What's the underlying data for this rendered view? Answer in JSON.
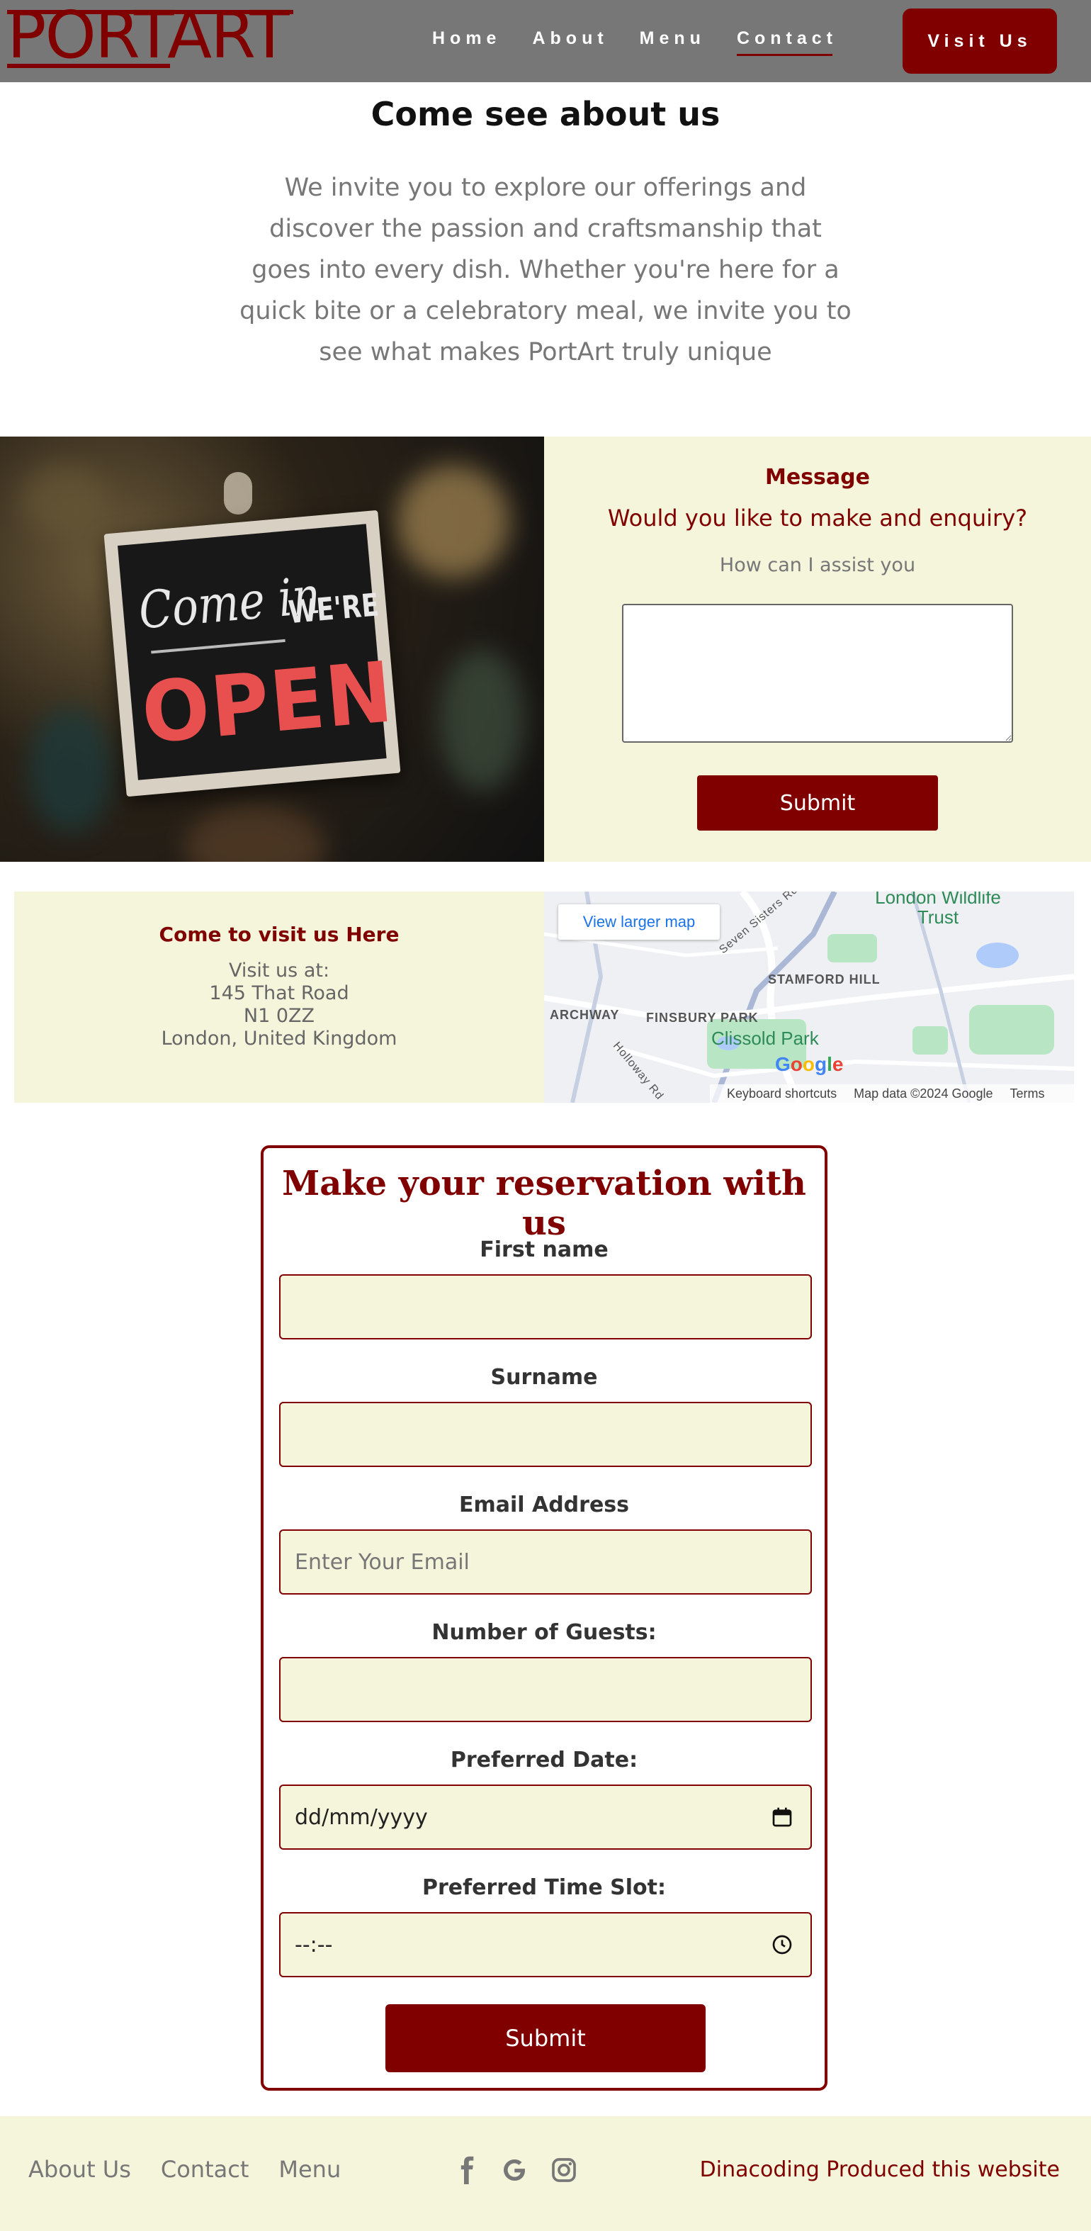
{
  "brand": {
    "logo_text": "PORTART"
  },
  "nav": {
    "links": [
      "Home",
      "About",
      "Menu",
      "Contact"
    ],
    "active": "Contact",
    "visit_button": "Visit Us"
  },
  "intro": {
    "title": "Come see about us",
    "text": "We invite you to explore our offerings and discover the passion and craftsmanship that goes into every dish. Whether you're here for a quick bite or a celebratory meal, we invite you to see what makes PortArt truly unique"
  },
  "photo": {
    "sign_line1": "Come in",
    "sign_line2": "WE'RE",
    "sign_line3": "OPEN"
  },
  "message": {
    "label": "Message",
    "title": "Would you like to make and enquiry?",
    "subtitle": "How can I assist you",
    "textarea_value": "",
    "submit": "Submit"
  },
  "visit": {
    "title": "Come to visit us Here",
    "lines": [
      "Visit us at:",
      "145 That Road",
      "N1 0ZZ",
      "London, United Kingdom"
    ]
  },
  "map": {
    "larger_link": "View larger map",
    "labels": [
      "London Wildlife Trust",
      "STAMFORD HILL",
      "ARCHWAY",
      "FINSBURY PARK",
      "Clissold Park",
      "Seven Sisters Rd",
      "Holloway Rd"
    ],
    "logo": "Google",
    "footer": [
      "Keyboard shortcuts",
      "Map data ©2024 Google",
      "Terms"
    ]
  },
  "reservation": {
    "title": "Make your reservation with us",
    "fields": [
      {
        "label": "First name",
        "value": "",
        "placeholder": ""
      },
      {
        "label": "Surname",
        "value": "",
        "placeholder": ""
      },
      {
        "label": "Email Address",
        "value": "",
        "placeholder": "Enter Your Email"
      },
      {
        "label": "Number of Guests:",
        "value": "",
        "placeholder": ""
      },
      {
        "label": "Preferred Date:",
        "value": "dd/mm/yyyy",
        "placeholder": ""
      },
      {
        "label": "Preferred Time Slot:",
        "value": "--:--",
        "placeholder": ""
      }
    ],
    "submit": "Submit"
  },
  "footer": {
    "links": [
      "About Us",
      "Contact",
      "Menu"
    ],
    "social_icons": [
      "facebook-icon",
      "google-icon",
      "instagram-icon"
    ],
    "credit": "Dinacoding Produced this website"
  },
  "colors": {
    "brand": "#800000",
    "cream": "#f5f5dc",
    "nav_bg": "#777777"
  }
}
